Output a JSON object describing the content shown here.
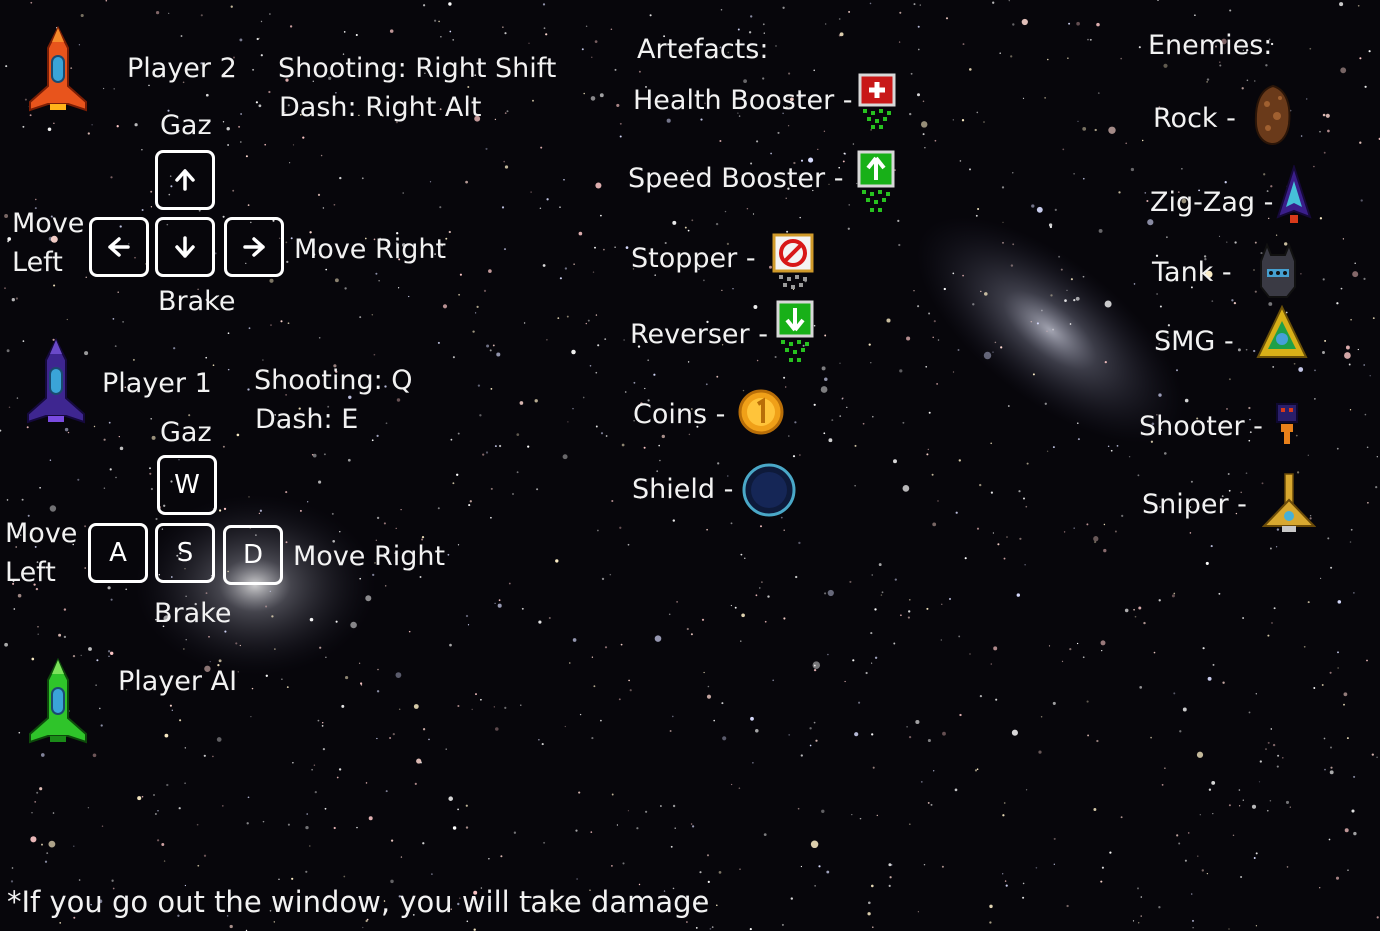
{
  "player2": {
    "name": "Player 2",
    "shooting": "Shooting: Right Shift",
    "dash": "Dash: Right Alt",
    "up_label": "Gaz",
    "down_label": "Brake",
    "left_label_1": "Move",
    "left_label_2": "Left",
    "right_label": "Move Right",
    "ship_icon": "red-rocket-icon",
    "keys": {
      "up": "arrow-up-icon",
      "left": "arrow-left-icon",
      "down": "arrow-down-icon",
      "right": "arrow-right-icon"
    }
  },
  "player1": {
    "name": "Player 1",
    "shooting": "Shooting: Q",
    "dash": "Dash: E",
    "up_label": "Gaz",
    "down_label": "Brake",
    "left_label_1": "Move",
    "left_label_2": "Left",
    "right_label": "Move Right",
    "ship_icon": "purple-rocket-icon",
    "keys": {
      "up": "W",
      "left": "A",
      "down": "S",
      "right": "D"
    }
  },
  "player_ai": {
    "name": "Player AI",
    "ship_icon": "green-rocket-icon"
  },
  "artefacts": {
    "title": "Artefacts:",
    "items": [
      {
        "label": "Health Booster -",
        "icon": "health-booster-icon"
      },
      {
        "label": "Speed Booster -",
        "icon": "speed-booster-icon"
      },
      {
        "label": "Stopper -",
        "icon": "stopper-icon"
      },
      {
        "label": "Reverser -",
        "icon": "reverser-icon"
      },
      {
        "label": "Coins -",
        "icon": "coin-icon"
      },
      {
        "label": "Shield -",
        "icon": "shield-icon"
      }
    ]
  },
  "enemies": {
    "title": "Enemies:",
    "items": [
      {
        "label": "Rock -",
        "icon": "rock-enemy-icon"
      },
      {
        "label": "Zig-Zag -",
        "icon": "zigzag-enemy-icon"
      },
      {
        "label": "Tank -",
        "icon": "tank-enemy-icon"
      },
      {
        "label": "SMG -",
        "icon": "smg-enemy-icon"
      },
      {
        "label": "Shooter -",
        "icon": "shooter-enemy-icon"
      },
      {
        "label": "Sniper -",
        "icon": "sniper-enemy-icon"
      }
    ]
  },
  "footer_note": "*If you go out the window, you will take damage",
  "colors": {
    "background": "#07060b",
    "text": "#f2f2f2",
    "key_border": "#ffffff",
    "player2_ship": "#e8541c",
    "player1_ship": "#4a2a9a",
    "player_ai_ship": "#2fc42a"
  }
}
